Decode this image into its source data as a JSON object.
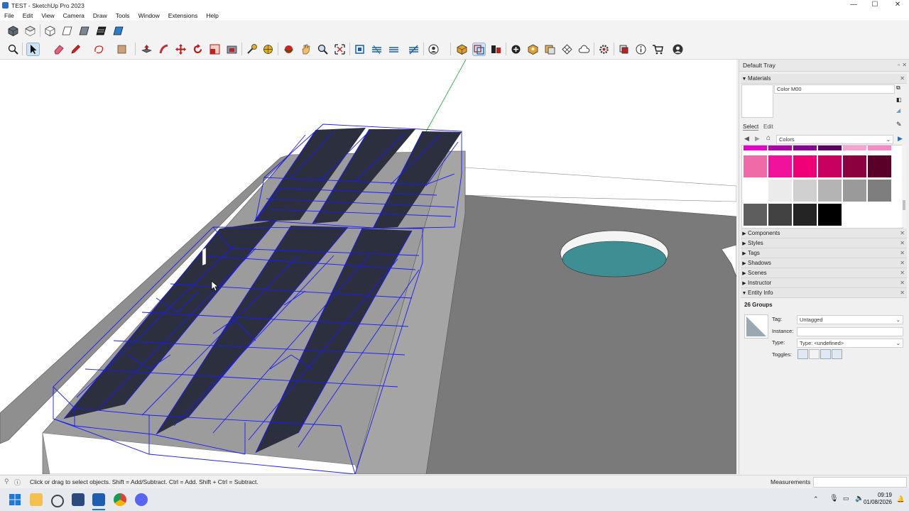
{
  "window": {
    "title": "TEST - SketchUp Pro 2023",
    "controls": [
      "—",
      "☐",
      "✕"
    ]
  },
  "menu": [
    "File",
    "Edit",
    "View",
    "Camera",
    "Draw",
    "Tools",
    "Window",
    "Extensions",
    "Help"
  ],
  "toolbar_icons_row1": [
    "iso-view-icon",
    "top-view-icon",
    "front-view-icon",
    "right-view-icon",
    "back-view-icon",
    "left-view-icon",
    "bottom-view-icon"
  ],
  "toolbar_icons_row2": [
    "zoom-window-icon",
    "select-icon",
    "eraser-icon",
    "pencil-line-icon",
    "freehand-shape-icon",
    "paint-bucket-icon",
    "push-pull-icon",
    "follow-me-icon",
    "move-icon",
    "rotate-icon",
    "scale-icon",
    "offset-icon",
    "tape-measure-icon",
    "protractor-icon",
    "orbit-icon",
    "pan-icon",
    "zoom-icon",
    "zoom-extents-icon",
    "section-plane-icon",
    "section-cut-icon",
    "section-fill-icon",
    "section-display-icon",
    "user-menu-icon",
    "3d-warehouse-icon",
    "extension-warehouse-icon",
    "layout-icon",
    "add-location-icon",
    "geo-location-icon",
    "photo-texture-icon",
    "sandbox-icon",
    "cloud-icon",
    "settings-icon",
    "component-icon",
    "info-icon",
    "cart-icon",
    "account-icon"
  ],
  "tray": {
    "title": "Default Tray",
    "materials": {
      "header": "Materials",
      "material_name": "Color M00",
      "tab_select": "Select",
      "tab_edit": "Edit",
      "library": "Colors",
      "swatches": [
        [
          "#e600c8",
          "#b000a8",
          "#8a0090",
          "#5a0060",
          "#f7a2d0",
          "#f58cc6"
        ],
        [
          "#f06aa8",
          "#f0129a",
          "#ef0078",
          "#c80060",
          "#8c0040",
          "#5a0028"
        ],
        [
          "#ffffff",
          "#ebebeb",
          "#d0d0d0",
          "#b4b4b4",
          "#9a9a9a",
          "#7e7e7e"
        ],
        [
          "#5e5e5e",
          "#424242",
          "#242424",
          "#000000"
        ]
      ]
    },
    "panels": [
      "Components",
      "Styles",
      "Tags",
      "Shadows",
      "Scenes",
      "Instructor",
      "Entity Info"
    ],
    "entity_info": {
      "summary": "26 Groups",
      "tag_label": "Tag:",
      "tag_value": "Untagged",
      "instance_label": "Instance:",
      "instance_value": "",
      "type_label": "Type:",
      "type_value": "Type: <undefined>",
      "toggles_label": "Toggles:"
    }
  },
  "status_bar": {
    "message": "Click or drag to select objects. Shift = Add/Subtract. Ctrl = Add. Shift + Ctrl = Subtract.",
    "measurements_label": "Measurements"
  },
  "taskbar": {
    "time": "09:19",
    "date": "01/08/2026"
  },
  "colors": {
    "selection_blue": "#1a1aff",
    "panel_dark": "#2c2f3d",
    "roof_grey": "#7a7a7a",
    "skylight_teal": "#3d8f94"
  }
}
